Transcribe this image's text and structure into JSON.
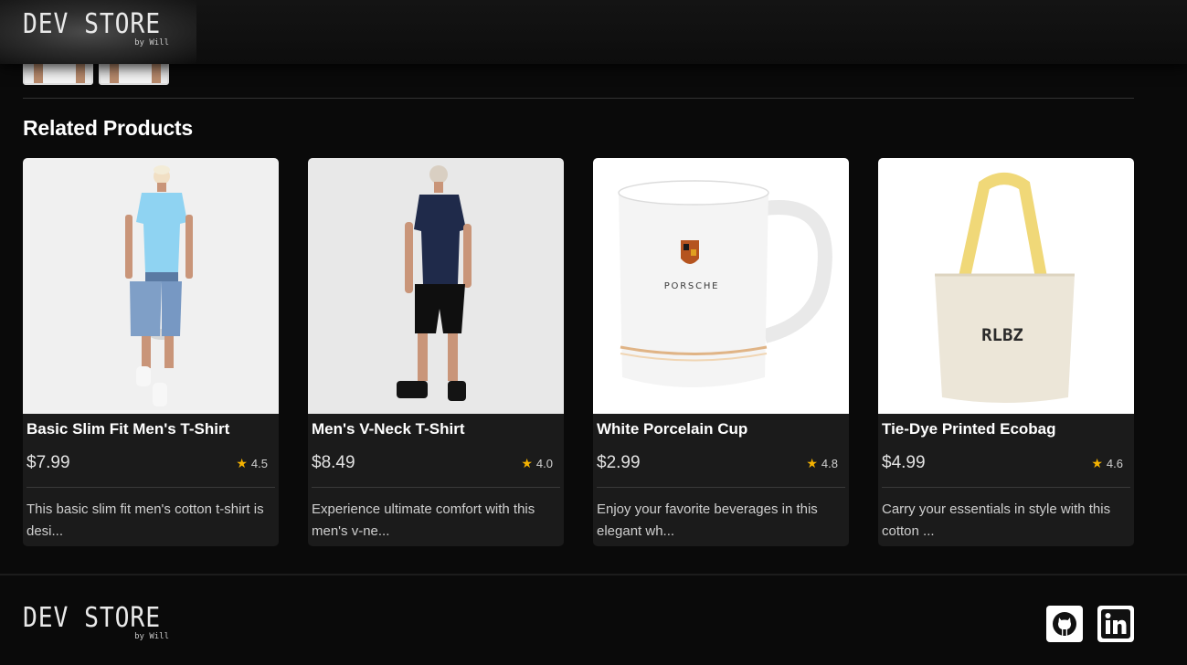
{
  "brand": {
    "name": "DEV STORE",
    "byline": "by Will"
  },
  "section": {
    "title": "Related Products"
  },
  "products": [
    {
      "name": "Basic Slim Fit Men's T-Shirt",
      "price": "$7.99",
      "rating": "4.5",
      "description": "This basic slim fit men's cotton t-shirt is desi...",
      "image": "man-light-blue-tshirt-denim-shorts"
    },
    {
      "name": "Men's V-Neck T-Shirt",
      "price": "$8.49",
      "rating": "4.0",
      "description": "Experience ultimate comfort with this men's v-ne...",
      "image": "man-navy-tshirt-back-view"
    },
    {
      "name": "White Porcelain Cup",
      "price": "$2.99",
      "rating": "4.8",
      "description": "Enjoy your favorite beverages in this elegant wh...",
      "image": "white-porsche-mug",
      "image_text": "PORSCHE"
    },
    {
      "name": "Tie-Dye Printed Ecobag",
      "price": "$4.99",
      "rating": "4.6",
      "description": "Carry your essentials in style with this cotton ...",
      "image": "canvas-tote-bag",
      "image_text": "RLBZ"
    }
  ],
  "footer": {
    "social": [
      "github-icon",
      "linkedin-icon"
    ]
  },
  "colors": {
    "star": "#f5b301",
    "card_bg": "#1b1b1b",
    "page_bg": "#0a0a0a"
  }
}
